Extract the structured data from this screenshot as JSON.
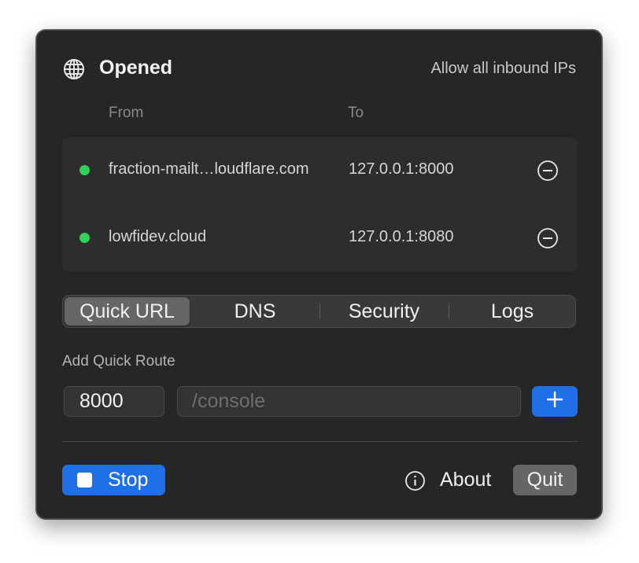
{
  "header": {
    "title": "Opened",
    "allow_all_link": "Allow all inbound IPs",
    "icon": "globe-icon"
  },
  "routes": {
    "columns": {
      "from": "From",
      "to": "To"
    },
    "items": [
      {
        "from": "fraction-mailt…loudflare.com",
        "to": "127.0.0.1:8000",
        "status": "active",
        "status_color": "#30d158"
      },
      {
        "from": "lowfidev.cloud",
        "to": "127.0.0.1:8080",
        "status": "active",
        "status_color": "#30d158"
      }
    ]
  },
  "tabs": [
    {
      "label": "Quick URL",
      "selected": true
    },
    {
      "label": "DNS",
      "selected": false
    },
    {
      "label": "Security",
      "selected": false
    },
    {
      "label": "Logs",
      "selected": false
    }
  ],
  "quick_route": {
    "label": "Add Quick Route",
    "port_value": "8000",
    "path_value": "",
    "path_placeholder": "/console",
    "add_icon": "plus-icon"
  },
  "footer": {
    "stop_label": "Stop",
    "about_label": "About",
    "quit_label": "Quit"
  },
  "colors": {
    "accent": "#1f6fe6",
    "status_active": "#30d158",
    "panel_background": "#262626"
  }
}
